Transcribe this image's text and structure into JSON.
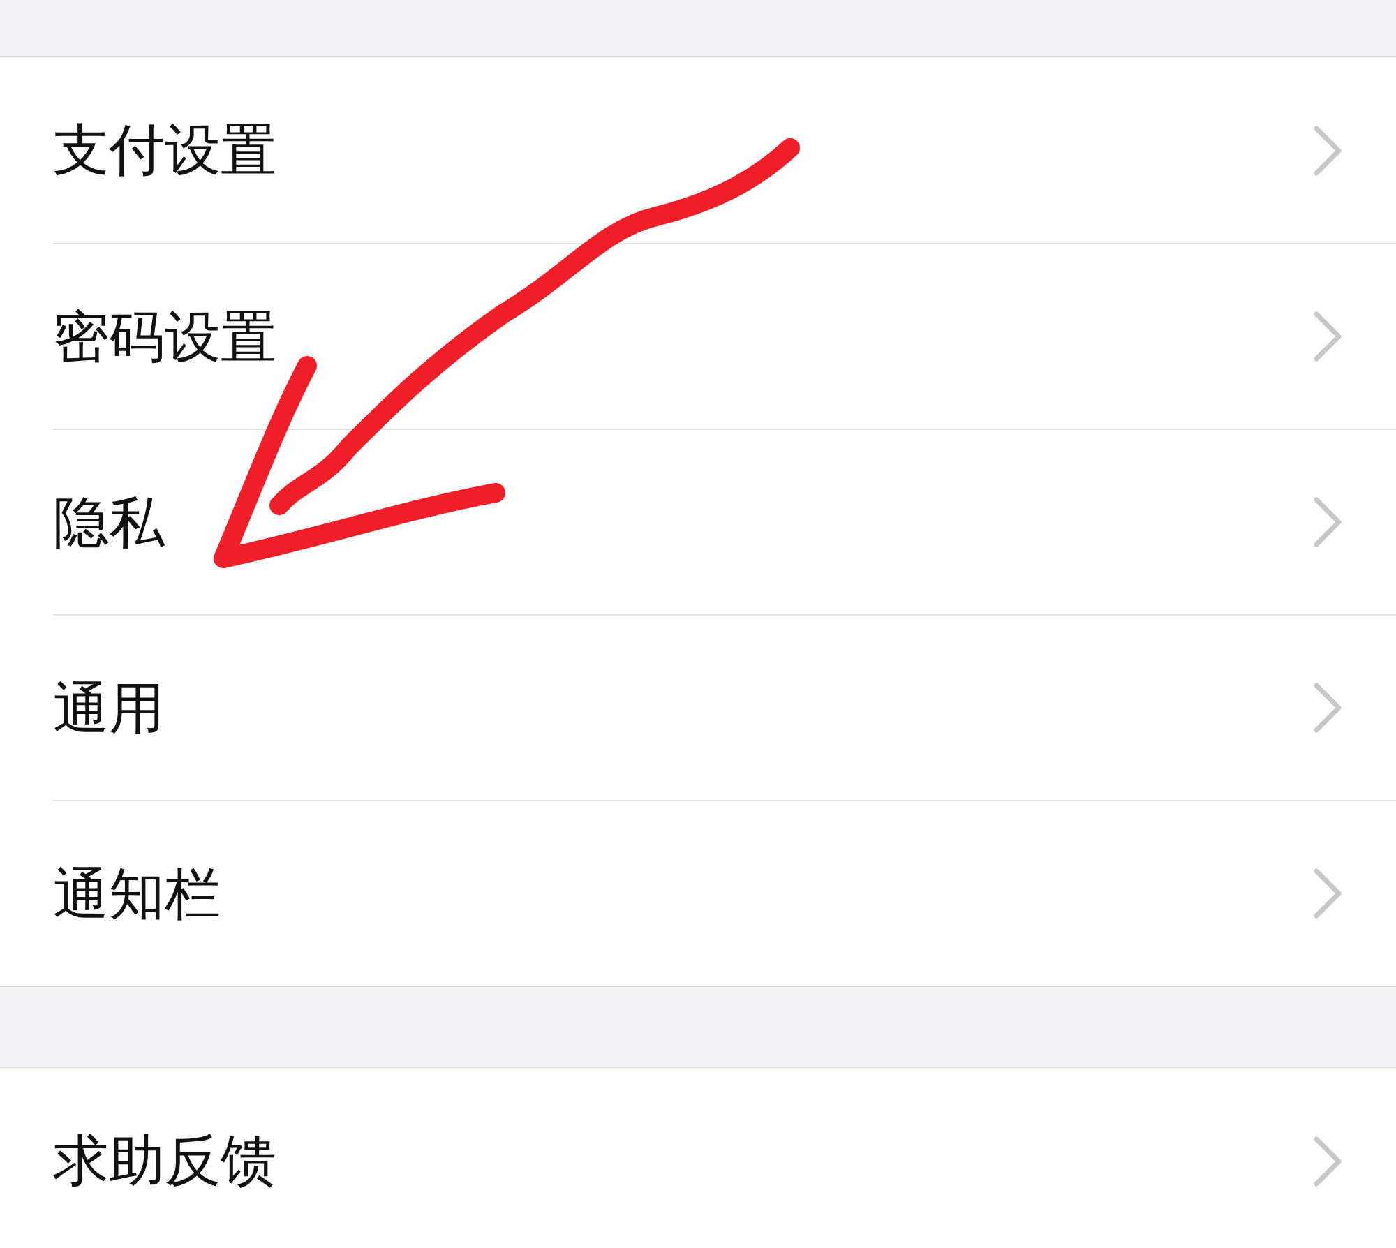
{
  "sections": [
    {
      "items": [
        {
          "label": "支付设置"
        },
        {
          "label": "密码设置"
        },
        {
          "label": "隐私"
        },
        {
          "label": "通用"
        },
        {
          "label": "通知栏"
        }
      ]
    },
    {
      "items": [
        {
          "label": "求助反馈"
        }
      ]
    }
  ]
}
